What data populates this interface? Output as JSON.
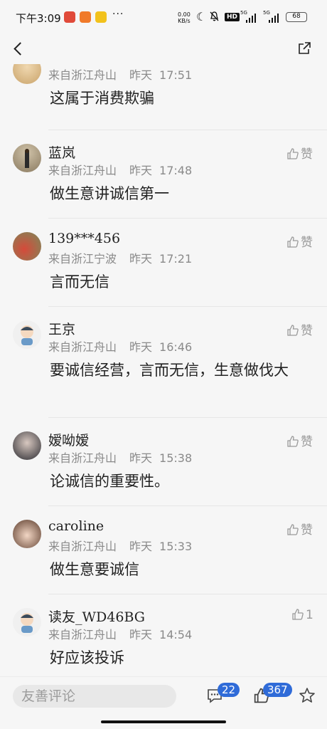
{
  "status_bar": {
    "time": "下午3:09",
    "dots": "···",
    "net_speed_value": "0.00",
    "net_speed_unit": "KB/s",
    "hd_label": "HD",
    "signal1_label": "5G",
    "signal2_label": "5G",
    "battery": "68",
    "colors": {
      "app1": "#e04a3a",
      "app2": "#f07a2a",
      "app3": "#f2c21c"
    }
  },
  "nav": {
    "back_icon": "chevron-left-icon",
    "share_icon": "share-icon"
  },
  "comments": [
    {
      "username": "",
      "location": "来自浙江舟山",
      "day": "昨天",
      "time": "17:51",
      "content": "这属于消费欺骗",
      "like": ""
    },
    {
      "username": "蓝岚",
      "location": "来自浙江舟山",
      "day": "昨天",
      "time": "17:48",
      "content": "做生意讲诚信第一",
      "like": "赞"
    },
    {
      "username": "139***456",
      "location": "来自浙江宁波",
      "day": "昨天",
      "time": "17:21",
      "content": "言而无信",
      "like": "赞"
    },
    {
      "username": "王京",
      "location": "来自浙江舟山",
      "day": "昨天",
      "time": "16:46",
      "content": "要诚信经营，言而无信，生意做伐大",
      "like": "赞"
    },
    {
      "username": "嫒呦嫒",
      "location": "来自浙江舟山",
      "day": "昨天",
      "time": "15:38",
      "content": "论诚信的重要性。",
      "like": "赞"
    },
    {
      "username": "caroline",
      "location": "来自浙江舟山",
      "day": "昨天",
      "time": "15:33",
      "content": "做生意要诚信",
      "like": "赞"
    },
    {
      "username": "读友_WD46BG",
      "location": "来自浙江舟山",
      "day": "昨天",
      "time": "14:54",
      "content": "好应该投诉",
      "like": "1"
    }
  ],
  "bottom_bar": {
    "input_placeholder": "友善评论",
    "comment_count": "22",
    "like_count": "367",
    "accent": "#2f6bd8"
  }
}
